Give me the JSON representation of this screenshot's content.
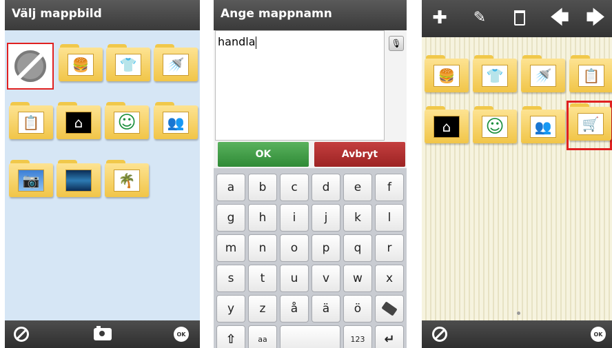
{
  "screen1": {
    "title": "Välj mappbild",
    "icons": {
      "no_picture": "no-picture-icon",
      "cancel": "cancel-icon",
      "camera": "camera-icon",
      "ok": "ok-icon"
    },
    "ok_label": "OK"
  },
  "screen2": {
    "title": "Ange mappnamn",
    "input_value": "handla",
    "ok_button": "OK",
    "cancel_button": "Avbryt",
    "keyboard": {
      "row1": [
        "a",
        "b",
        "c",
        "d",
        "e",
        "f"
      ],
      "row2": [
        "g",
        "h",
        "i",
        "j",
        "k",
        "l"
      ],
      "row3": [
        "m",
        "n",
        "o",
        "p",
        "q",
        "r"
      ],
      "row4": [
        "s",
        "t",
        "u",
        "v",
        "w",
        "x"
      ],
      "row5": [
        "y",
        "z",
        "å",
        "ä",
        "ö"
      ],
      "case_key": "aa",
      "numbers_key": "123"
    }
  },
  "screen3": {
    "ok_label": "OK"
  },
  "colors": {
    "accent_red": "#e02020",
    "ok_green": "#2f8a36",
    "cancel_red": "#9c2323",
    "folder_yellow": "#f1c548"
  }
}
